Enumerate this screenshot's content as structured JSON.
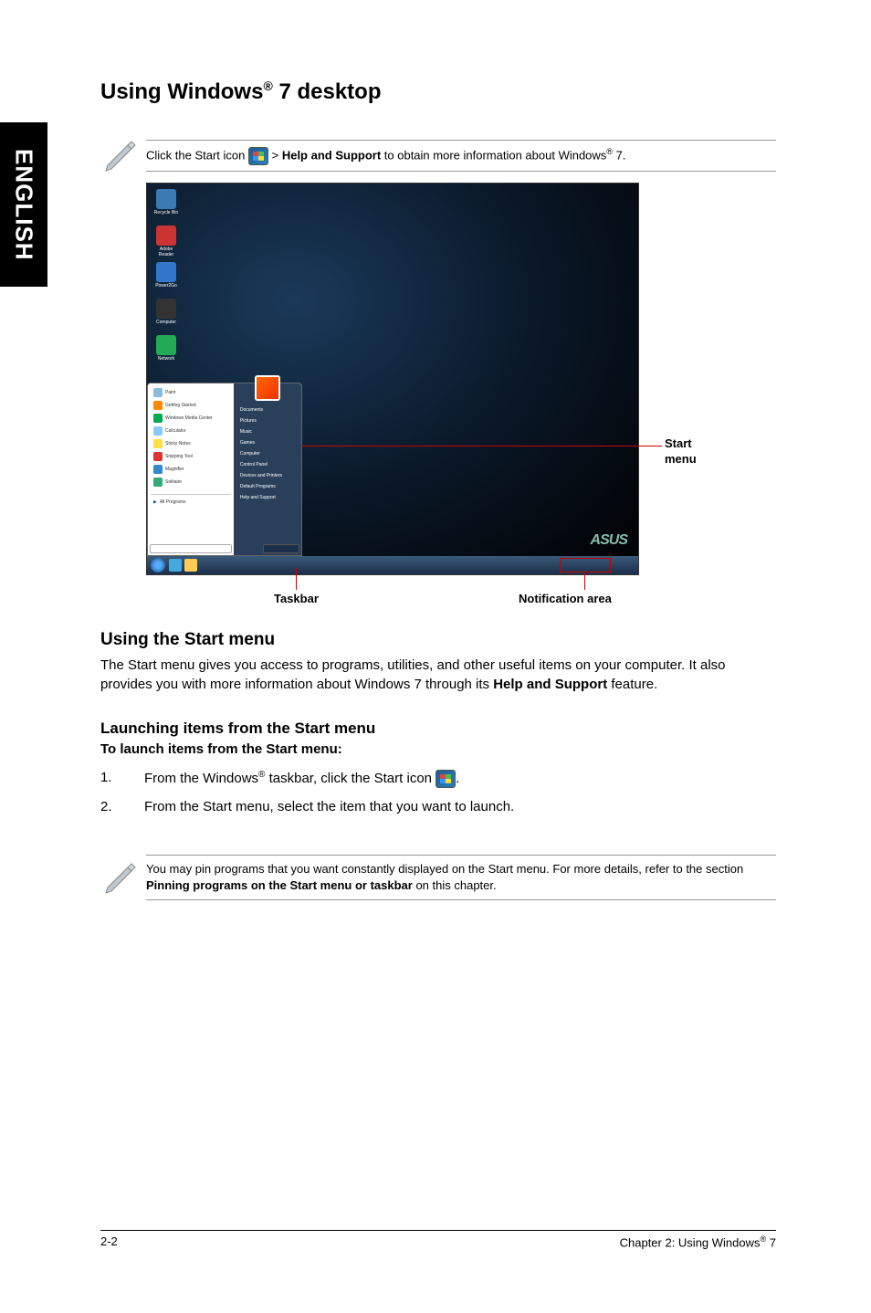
{
  "sidebar_language": "ENGLISH",
  "main_heading_prefix": "Using Windows",
  "main_heading_suffix": " 7 desktop",
  "tip_prefix": "Click the Start icon ",
  "tip_bold": "Help and Support",
  "tip_suffix": " to obtain more information about Windows",
  "tip_end": " 7.",
  "screenshot": {
    "desktop_icons": [
      {
        "label": "Recycle Bin",
        "color": "#3a7ab5"
      },
      {
        "label": "Adobe Reader",
        "color": "#c33"
      },
      {
        "label": "Power2Go",
        "color": "#37c"
      },
      {
        "label": "Computer",
        "color": "#333"
      },
      {
        "label": "Network",
        "color": "#2a5"
      }
    ],
    "start_left_items": [
      {
        "label": "Paint",
        "color": "#8bd"
      },
      {
        "label": "Getting Started",
        "color": "#f80"
      },
      {
        "label": "Windows Media Center",
        "color": "#0a5"
      },
      {
        "label": "Calculator",
        "color": "#8cf"
      },
      {
        "label": "Sticky Notes",
        "color": "#fd4"
      },
      {
        "label": "Snipping Tool",
        "color": "#d33"
      },
      {
        "label": "Magnifier",
        "color": "#38c"
      },
      {
        "label": "Solitaire",
        "color": "#3a7"
      }
    ],
    "start_all_programs": "All Programs",
    "start_right_items": [
      "Documents",
      "Pictures",
      "Music",
      "Games",
      "Computer",
      "Control Panel",
      "Devices and Printers",
      "Default Programs",
      "Help and Support"
    ],
    "asus": "ASUS"
  },
  "callouts": {
    "start_menu": "Start\nmenu",
    "taskbar": "Taskbar",
    "notification": "Notification area"
  },
  "section1_heading": "Using the Start menu",
  "section1_body_part1": "The Start menu gives you access to programs, utilities, and other useful items on your computer. It also provides you with more information about Windows 7 through its ",
  "section1_body_bold": "Help and Support",
  "section1_body_part2": " feature.",
  "section2_heading": "Launching items from the Start menu",
  "section2_subhead": "To launch items from the Start menu:",
  "steps": [
    {
      "num": "1.",
      "prefix": "From the Windows",
      "suffix": " taskbar, click the Start icon ",
      "end": ".",
      "has_icon": true
    },
    {
      "num": "2.",
      "prefix": "From the Start menu, select the item that you want to launch.",
      "suffix": "",
      "end": "",
      "has_icon": false
    }
  ],
  "note2_part1": "You may pin programs that you want constantly displayed on the Start menu. For more details, refer to the section ",
  "note2_bold": "Pinning programs on the Start menu or taskbar",
  "note2_part2": " on this chapter.",
  "footer_left": "2-2",
  "footer_right_prefix": "Chapter 2: Using Windows",
  "footer_right_suffix": " 7"
}
